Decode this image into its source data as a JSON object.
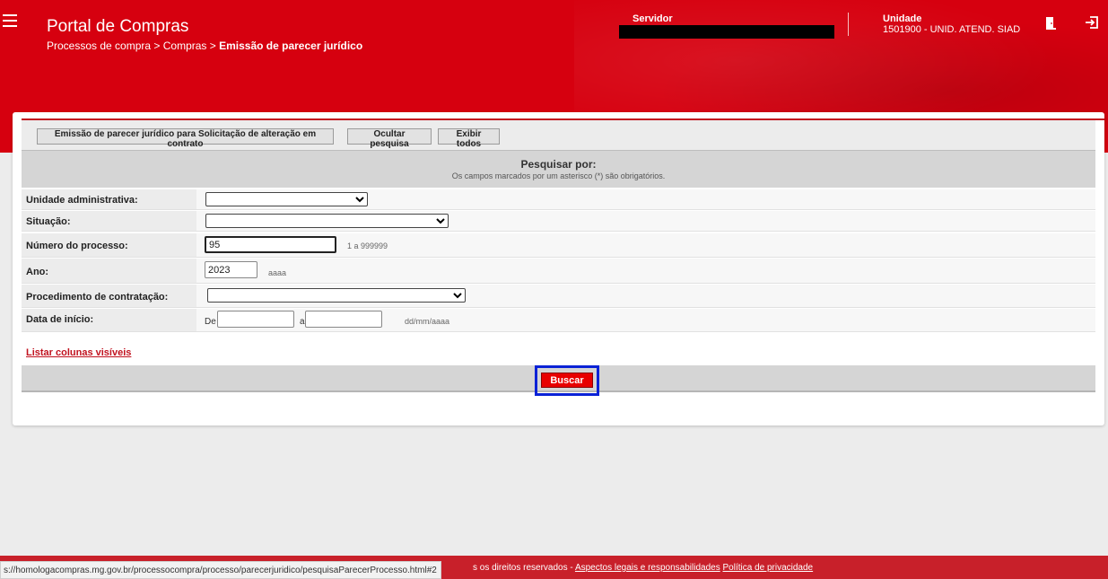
{
  "header": {
    "portal_title": "Portal de Compras",
    "breadcrumb_prefix": "Processos de compra > Compras > ",
    "breadcrumb_current": "Emissão de parecer jurídico",
    "servidor_label": "Servidor",
    "unidade_label": "Unidade",
    "unidade_value": "1501900 - UNID. ATEND. SIAD",
    "colors": {
      "brand": "#d6000f"
    }
  },
  "toolbar": {
    "btn_emissao": "Emissão de parecer jurídico para Solicitação de alteração em contrato",
    "btn_ocultar": "Ocultar pesquisa",
    "btn_exibir": "Exibir todos"
  },
  "search": {
    "title": "Pesquisar por:",
    "subtitle": "Os campos marcados por um asterisco (*) são obrigatórios.",
    "unidade_label": "Unidade administrativa:",
    "unidade_value": "",
    "situacao_label": "Situação:",
    "situacao_value": "",
    "numero_label": "Número do processo:",
    "numero_value": "95",
    "numero_hint": "1 a 999999",
    "ano_label": "Ano:",
    "ano_value": "2023",
    "ano_hint": "aaaa",
    "procedimento_label": "Procedimento de contratação:",
    "procedimento_value": "",
    "data_label": "Data de início:",
    "data_de": "De",
    "data_a": "a",
    "data_de_value": "",
    "data_a_value": "",
    "data_hint": "dd/mm/aaaa",
    "listar_link": "Listar colunas visíveis",
    "buscar_label": "Buscar"
  },
  "footer": {
    "status_url": "s://homologacompras.mg.gov.br/processocompra/processo/parecerjuridico/pesquisaParecerProcesso.html#2",
    "rights_text": "s os direitos reservados - ",
    "link_aspectos": "Aspectos legais e responsabilidades",
    "link_privacidade": "Política de privacidade"
  }
}
